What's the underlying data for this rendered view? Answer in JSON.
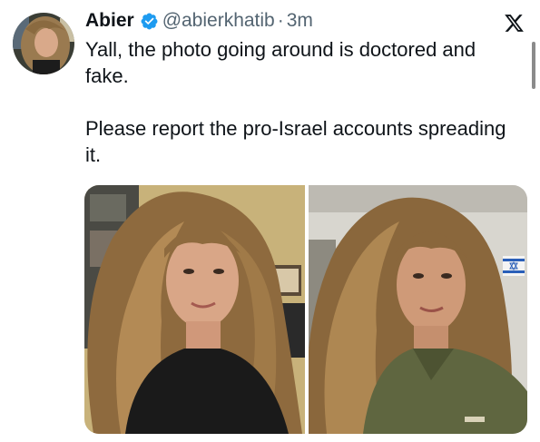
{
  "tweet": {
    "author": {
      "display_name": "Abier",
      "handle": "@abierkhatib",
      "verified": true
    },
    "separator": "·",
    "timestamp": "3m",
    "text_paragraphs": [
      "Yall, the photo going around is doctored and fake.",
      "Please report the pro-Israel accounts spreading it."
    ],
    "media": [
      {
        "icon": "photo-woman-curly-hair-black-top"
      },
      {
        "icon": "photo-woman-curly-hair-olive-uniform-flag"
      }
    ]
  },
  "icons": {
    "verified": "verified-badge-icon",
    "brand": "x-logo-icon"
  },
  "colors": {
    "text": "#0f1419",
    "secondary_text": "#536471",
    "verified_blue": "#1d9bf0"
  }
}
